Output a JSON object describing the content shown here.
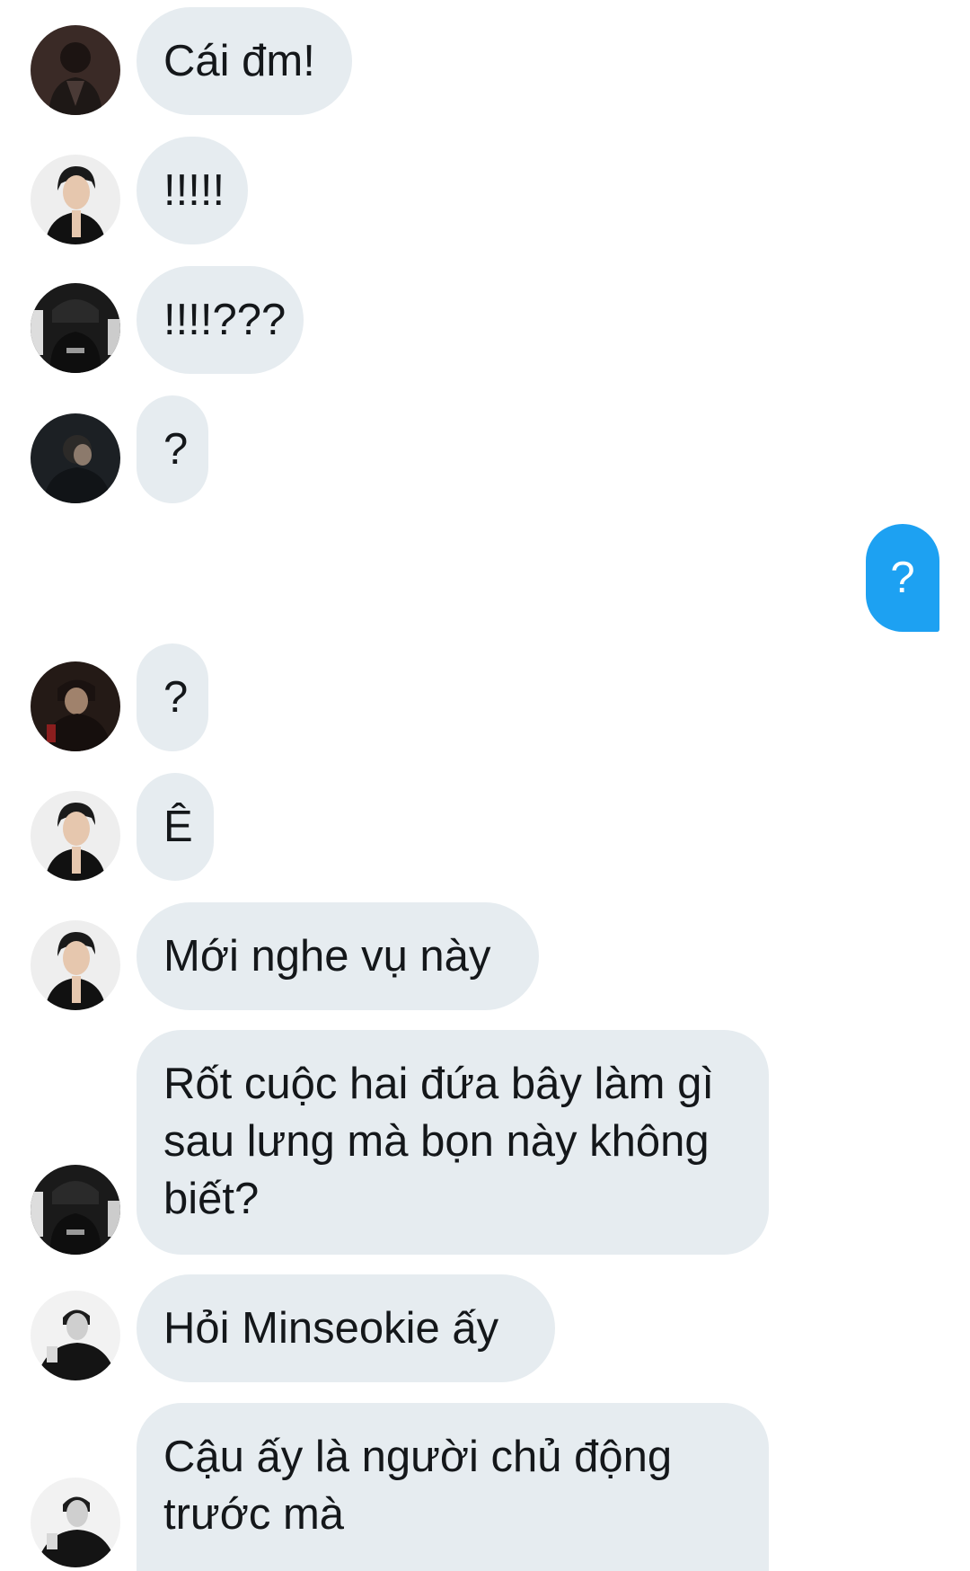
{
  "colors": {
    "incoming_bubble": "#e6ecf0",
    "outgoing_bubble": "#1da1f2",
    "incoming_text": "#14171a",
    "outgoing_text": "#ffffff"
  },
  "messages": [
    {
      "direction": "incoming",
      "avatar": "avatar-a",
      "text": "Cái đm!"
    },
    {
      "direction": "incoming",
      "avatar": "avatar-b",
      "text": "!!!!!"
    },
    {
      "direction": "incoming",
      "avatar": "avatar-c",
      "text": "!!!!???"
    },
    {
      "direction": "incoming",
      "avatar": "avatar-d",
      "text": "?"
    },
    {
      "direction": "outgoing",
      "text": "?"
    },
    {
      "direction": "incoming",
      "avatar": "avatar-e",
      "text": "?"
    },
    {
      "direction": "incoming",
      "avatar": "avatar-b",
      "text": "Ê"
    },
    {
      "direction": "incoming",
      "avatar": "avatar-b",
      "text": "Mới nghe vụ này"
    },
    {
      "direction": "incoming",
      "avatar": "avatar-c",
      "text": "Rốt cuộc hai đứa bây làm gì sau lưng mà bọn này không biết?"
    },
    {
      "direction": "incoming",
      "avatar": "avatar-f",
      "text": "Hỏi Minseokie ấy"
    },
    {
      "direction": "incoming",
      "avatar": "avatar-f",
      "text": "Cậu ấy là người chủ động trước mà"
    }
  ]
}
